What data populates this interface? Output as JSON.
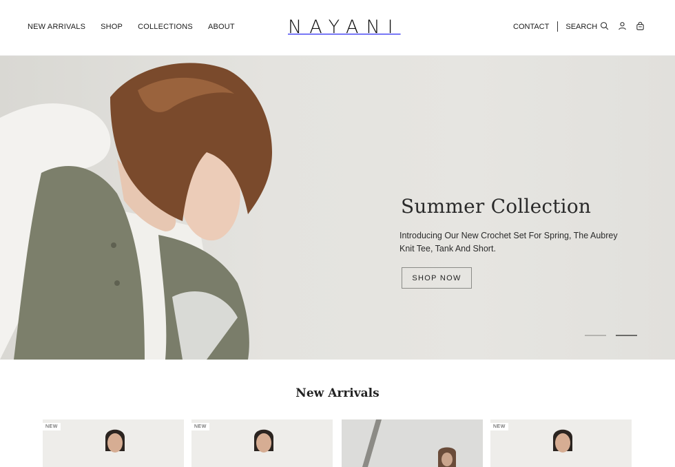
{
  "brand": {
    "logo": "NAYANI"
  },
  "nav": {
    "left": [
      "NEW ARRIVALS",
      "SHOP",
      "COLLECTIONS",
      "ABOUT"
    ],
    "contact": "CONTACT",
    "search": "SEARCH",
    "icons": [
      "search-icon",
      "account-icon",
      "bag-icon"
    ]
  },
  "hero": {
    "title": "Summer Collection",
    "subtitle": "Introducing Our New Crochet Set For Spring, The Aubrey Knit Tee, Tank And Short.",
    "cta": "SHOP NOW",
    "slides": 2,
    "active_slide": 2
  },
  "new_arrivals": {
    "title": "New Arrivals",
    "products": [
      {
        "badge": "NEW"
      },
      {
        "badge": "NEW"
      },
      {
        "badge": ""
      },
      {
        "badge": "NEW"
      }
    ]
  }
}
